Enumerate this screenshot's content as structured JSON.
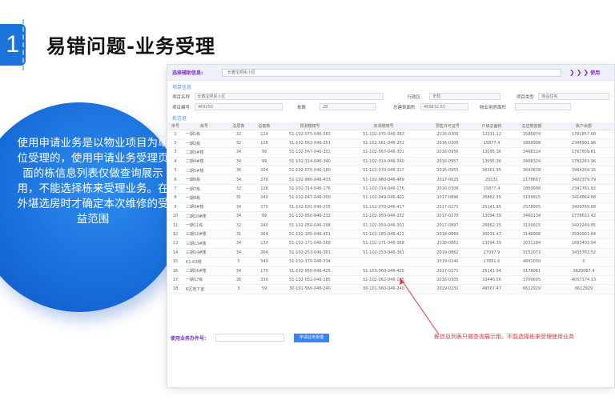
{
  "slide": {
    "number": "1",
    "title": "易错问题-业务受理",
    "description": "使用申请业务是以物业项目为单位受理的，使用申请业务受理页面的栋信息列表仅做查询展示用，不能选择栋来受理业务。在外堪选房时才确定本次维修的受益范围",
    "annotation": "栋信息列表只做查询展示用，不能选择栋来受理使用业务"
  },
  "screenshot": {
    "select_label": "选择辅助信息:",
    "select_value": "长春宝邦民小区",
    "nav_arrows": "❯❯❯",
    "nav_text": "使用",
    "project_section": "项目信息",
    "fields": {
      "name_label": "项目名称",
      "name_value": "长春宝邦民小区",
      "district_label": "行政区",
      "district_value": "市辖",
      "type_label": "项目类型",
      "type_value": "商品住宅",
      "code_label": "项目编号",
      "code_value": "469292",
      "count_label": "栋数",
      "count_value": "28",
      "balance_label": "总建筑面积",
      "balance_value": "469832.61",
      "mgmt_label": "物业用房面积"
    },
    "building_section": "栋信息",
    "headers": [
      "序号",
      "栋号",
      "总层数",
      "总套数",
      "预测楼幢号",
      "实测楼幢号",
      "预售许可证号",
      "户级总面积",
      "总应缴金额",
      "账户余额"
    ],
    "rows": [
      [
        "1",
        "一期1栋",
        "32",
        "124",
        "51-102-075-046-383",
        "51-102-075-046-383",
        "2016-0306",
        "12331.12",
        "3586874",
        "1781857.68"
      ],
      [
        "2",
        "一期2栋",
        "32",
        "128",
        "51-102-562-046-251",
        "51-102-561-046-251",
        "2016-0306",
        "15877.4",
        "1869908",
        "2348901.96"
      ],
      [
        "3",
        "二期3#楼",
        "34",
        "99",
        "51-102-567-046-301",
        "51-102-567-046-301",
        "2016-0956",
        "13095.36",
        "3468324",
        "1767809.81"
      ],
      [
        "4",
        "二期4#楼",
        "34",
        "99",
        "51-102-314-046-340",
        "51-102-314-046-340",
        "2016-0957",
        "13095.36",
        "3468324",
        "1782243.96"
      ],
      [
        "5",
        "二期5#楼",
        "36",
        "204",
        "51-102-070-046-180",
        "51-102-070-046-217",
        "2016-0955",
        "36361.95",
        "3643838",
        "3964264.16"
      ],
      [
        "6",
        "一期6栋",
        "34",
        "270",
        "51-102-980-046-433",
        "51-102-980-046-489",
        "2017-0025",
        "20131",
        "2178607",
        "3402379.79"
      ],
      [
        "7",
        "一期7栋",
        "32",
        "128",
        "51-102-314-046-176",
        "51-102-314-046-176",
        "2016-0306",
        "15877.4",
        "1869908",
        "2341761.92"
      ],
      [
        "8",
        "一期8栋",
        "31",
        "240",
        "51-102-047-046-300",
        "51-102-049-046-401",
        "2017-0896",
        "26862.35",
        "3109915",
        "3414864.68"
      ],
      [
        "9",
        "二期9#楼",
        "34",
        "270",
        "51-102-591-046-205",
        "51-102-070-046-417",
        "2017-0271",
        "25141.95",
        "2578905",
        "3409769.68"
      ],
      [
        "10",
        "二期10#楼",
        "34",
        "99",
        "51-102-950-046-232",
        "51-102-950-046-232",
        "2017-0270",
        "13094.39",
        "3460134",
        "1778611.42"
      ],
      [
        "11",
        "一期11栋",
        "32",
        "240",
        "51-102-050-046-298",
        "51-102-050-046-301",
        "2017-0897",
        "26862.35",
        "3109915",
        "3422249.85"
      ],
      [
        "12",
        "三期12#楼",
        "31",
        "264",
        "51-102-185-046-401",
        "51-102-185-046-421",
        "2018-0860",
        "30031.47",
        "3148906",
        "3590901.84"
      ],
      [
        "13",
        "三期13#楼",
        "34",
        "130",
        "51-102-171-046-368",
        "51-102-171-046-368",
        "2018-0861",
        "13094.39",
        "1631184",
        "1693403.94"
      ],
      [
        "14",
        "三期14#楼",
        "34",
        "264",
        "51-102-253-046-361",
        "51-102-253-046-361",
        "2019-0862",
        "27097.9",
        "3152073",
        "3435763.52"
      ],
      [
        "15",
        "K1-K3楼",
        "5",
        "549",
        "51-102-170-046-334",
        "",
        "2019-0240",
        "17861.6",
        "4841030",
        "0"
      ],
      [
        "16",
        "二期16#楼",
        "34",
        "170",
        "51-102-950-046-425",
        "51-103-060-046-425",
        "2017-0271",
        "25141.94",
        "3178061",
        "3620067.4"
      ],
      [
        "17",
        "一期17栋",
        "36",
        "330",
        "51-102-051-046-185",
        "51-102-062-046-185",
        "2016-0305",
        "33440.56",
        "3709605",
        "4057174.13"
      ],
      [
        "18",
        "K区地下室",
        "3",
        "59",
        "30-101-560-046-240",
        "30-101-560-046-240",
        "2019-0231",
        "49567.47",
        "6612929",
        "6612929"
      ]
    ],
    "bottom_label": "使用业务办件号:",
    "bottom_button": "申请业务受理"
  }
}
